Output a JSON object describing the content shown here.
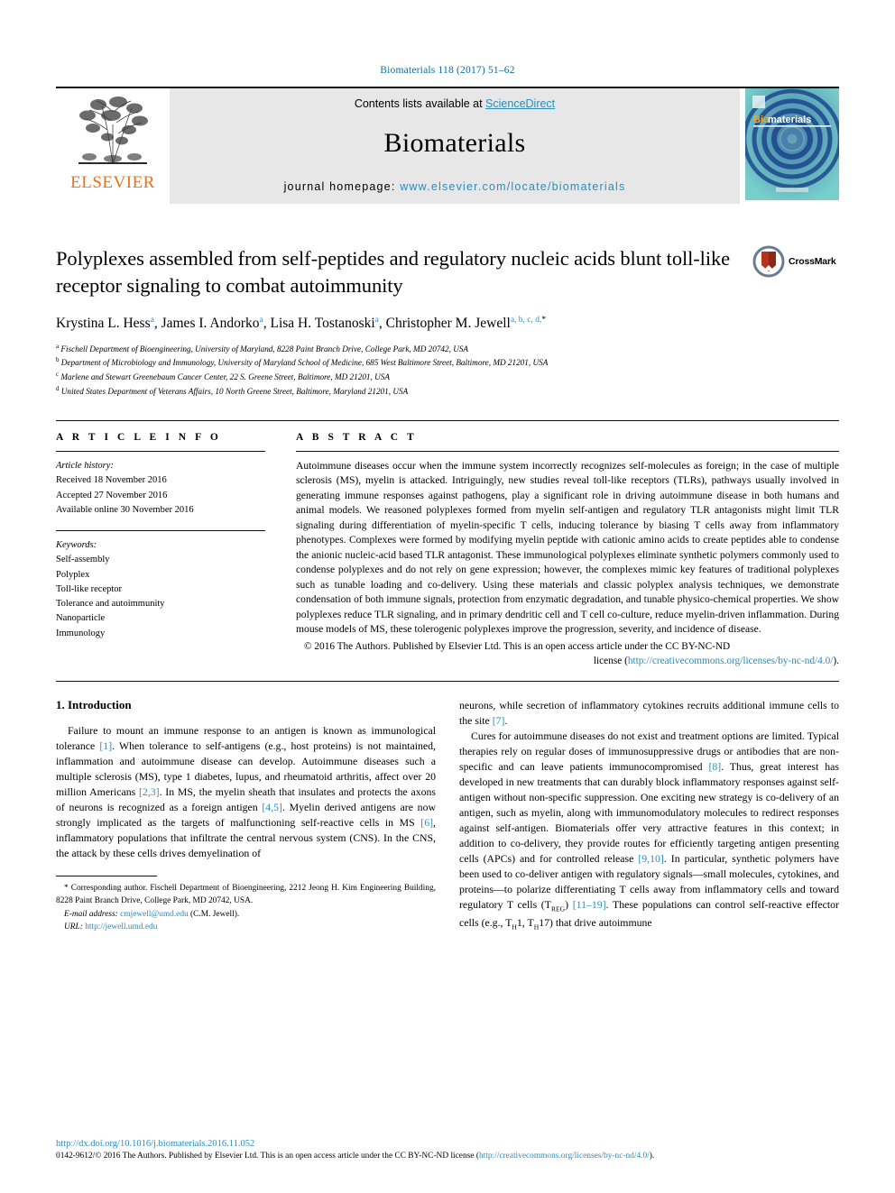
{
  "running_head": "Biomaterials 118 (2017) 51–62",
  "masthead": {
    "publisher": "ELSEVIER",
    "contents_prefix": "Contents lists available at ",
    "contents_link": "ScienceDirect",
    "journal_name": "Biomaterials",
    "homepage_prefix": "journal homepage: ",
    "homepage_link": "www.elsevier.com/locate/biomaterials",
    "cover_title_a": "Bio",
    "cover_title_b": "materials",
    "accent_link_color": "#2b8cbe",
    "elsevier_orange": "#E8731A"
  },
  "article": {
    "title": "Polyplexes assembled from self-peptides and regulatory nucleic acids blunt toll-like receptor signaling to combat autoimmunity",
    "crossmark_label": "CrossMark",
    "authors": [
      {
        "name": "Krystina L. Hess",
        "sup": "a",
        "sep": ", "
      },
      {
        "name": "James I. Andorko",
        "sup": "a",
        "sep": ", "
      },
      {
        "name": "Lisa H. Tostanoski",
        "sup": "a",
        "sep": ", "
      },
      {
        "name": "Christopher M. Jewell",
        "sup": "a, b, c, d,",
        "sep": ""
      }
    ],
    "affiliations": [
      {
        "mark": "a",
        "text": "Fischell Department of Bioengineering, University of Maryland, 8228 Paint Branch Drive, College Park, MD 20742, USA"
      },
      {
        "mark": "b",
        "text": "Department of Microbiology and Immunology, University of Maryland School of Medicine, 685 West Baltimore Street, Baltimore, MD 21201, USA"
      },
      {
        "mark": "c",
        "text": "Marlene and Stewart Greenebaum Cancer Center, 22 S. Greene Street, Baltimore, MD 21201, USA"
      },
      {
        "mark": "d",
        "text": "United States Department of Veterans Affairs, 10 North Greene Street, Baltimore, Maryland 21201, USA"
      }
    ]
  },
  "article_info": {
    "heading": "A R T I C L E   I N F O",
    "history_label": "Article history:",
    "history": [
      "Received 18 November 2016",
      "Accepted 27 November 2016",
      "Available online 30 November 2016"
    ],
    "keywords_label": "Keywords:",
    "keywords": [
      "Self-assembly",
      "Polyplex",
      "Toll-like receptor",
      "Tolerance and autoimmunity",
      "Nanoparticle",
      "Immunology"
    ]
  },
  "abstract": {
    "heading": "A B S T R A C T",
    "text": "Autoimmune diseases occur when the immune system incorrectly recognizes self-molecules as foreign; in the case of multiple sclerosis (MS), myelin is attacked. Intriguingly, new studies reveal toll-like receptors (TLRs), pathways usually involved in generating immune responses against pathogens, play a significant role in driving autoimmune disease in both humans and animal models. We reasoned polyplexes formed from myelin self-antigen and regulatory TLR antagonists might limit TLR signaling during differentiation of myelin-specific T cells, inducing tolerance by biasing T cells away from inflammatory phenotypes. Complexes were formed by modifying myelin peptide with cationic amino acids to create peptides able to condense the anionic nucleic-acid based TLR antagonist. These immunological polyplexes eliminate synthetic polymers commonly used to condense polyplexes and do not rely on gene expression; however, the complexes mimic key features of traditional polyplexes such as tunable loading and co-delivery. Using these materials and classic polyplex analysis techniques, we demonstrate condensation of both immune signals, protection from enzymatic degradation, and tunable physico-chemical properties. We show polyplexes reduce TLR signaling, and in primary dendritic cell and T cell co-culture, reduce myelin-driven inflammation. During mouse models of MS, these tolerogenic polyplexes improve the progression, severity, and incidence of disease.",
    "copyright_lead": "© 2016 The Authors. Published by Elsevier Ltd. This is an open access article under the CC BY-NC-ND",
    "copyright_tail": "license (",
    "copyright_link": "http://creativecommons.org/licenses/by-nc-nd/4.0/",
    "copyright_end": ")."
  },
  "body": {
    "section_number_title": "1.  Introduction",
    "left_paragraphs": [
      {
        "parts": [
          {
            "t": "Failure to mount an immune response to an antigen is known as immunological tolerance ",
            "cite": false
          },
          {
            "t": "[1]",
            "cite": true
          },
          {
            "t": ". When tolerance to self-antigens (e.g., host proteins) is not maintained, inflammation and autoimmune disease can develop. Autoimmune diseases such a multiple sclerosis (MS), type 1 diabetes, lupus, and rheumatoid arthritis, affect over 20 million Americans ",
            "cite": false
          },
          {
            "t": "[2,3]",
            "cite": true
          },
          {
            "t": ". In MS, the myelin sheath that insulates and protects the axons of neurons is recognized as a foreign antigen ",
            "cite": false
          },
          {
            "t": "[4,5]",
            "cite": true
          },
          {
            "t": ". Myelin derived antigens are now strongly implicated as the targets of malfunctioning self-reactive cells in MS ",
            "cite": false
          },
          {
            "t": "[6]",
            "cite": true
          },
          {
            "t": ", inflammatory populations that infiltrate the central nervous system (CNS). In the CNS, the attack by these cells drives demyelination of",
            "cite": false
          }
        ]
      }
    ],
    "right_paragraphs": [
      {
        "indent": false,
        "parts": [
          {
            "t": "neurons, while secretion of inflammatory cytokines recruits additional immune cells to the site ",
            "cite": false
          },
          {
            "t": "[7]",
            "cite": true
          },
          {
            "t": ".",
            "cite": false
          }
        ]
      },
      {
        "indent": true,
        "parts": [
          {
            "t": "Cures for autoimmune diseases do not exist and treatment options are limited. Typical therapies rely on regular doses of immunosuppressive drugs or antibodies that are non-specific and can leave patients immunocompromised ",
            "cite": false
          },
          {
            "t": "[8]",
            "cite": true
          },
          {
            "t": ". Thus, great interest has developed in new treatments that can durably block inflammatory responses against self-antigen without non-specific suppression. One exciting new strategy is co-delivery of an antigen, such as myelin, along with immunomodulatory molecules to redirect responses against self-antigen. Biomaterials offer very attractive features in this context; in addition to co-delivery, they provide routes for efficiently targeting antigen presenting cells (APCs) and for controlled release ",
            "cite": false
          },
          {
            "t": "[9,10]",
            "cite": true
          },
          {
            "t": ". In particular, synthetic polymers have been used to co-deliver antigen with regulatory signals—small molecules, cytokines, and proteins—to polarize differentiating T cells away from inflammatory cells and toward regulatory T cells (T",
            "cite": false
          },
          {
            "t": "REG",
            "cite": false,
            "sub": true
          },
          {
            "t": ") ",
            "cite": false
          },
          {
            "t": "[11–19]",
            "cite": true
          },
          {
            "t": ". These populations can control self-reactive effector cells (e.g., T",
            "cite": false
          },
          {
            "t": "H",
            "cite": false,
            "sub": true
          },
          {
            "t": "1, T",
            "cite": false
          },
          {
            "t": "H",
            "cite": false,
            "sub": true
          },
          {
            "t": "17) that drive autoimmune",
            "cite": false
          }
        ]
      }
    ]
  },
  "footnote": {
    "star": "*",
    "corresponding": " Corresponding author. Fischell Department of Bioengineering, 2212 Jeong H. Kim Engineering Building, 8228 Paint Branch Drive, College Park, MD 20742, USA.",
    "email_label": "E-mail address:",
    "email": "cmjewell@umd.edu",
    "email_owner": " (C.M. Jewell).",
    "url_label": "URL:",
    "url": "http://jewell.umd.edu"
  },
  "bottom": {
    "doi": "http://dx.doi.org/10.1016/j.biomaterials.2016.11.052",
    "issn_copyright": "0142-9612/© 2016 The Authors. Published by Elsevier Ltd. This is an open access article under the CC BY-NC-ND license (",
    "license_link": "http://creativecommons.org/licenses/by-nc-nd/4.0/",
    "license_end": ")."
  }
}
